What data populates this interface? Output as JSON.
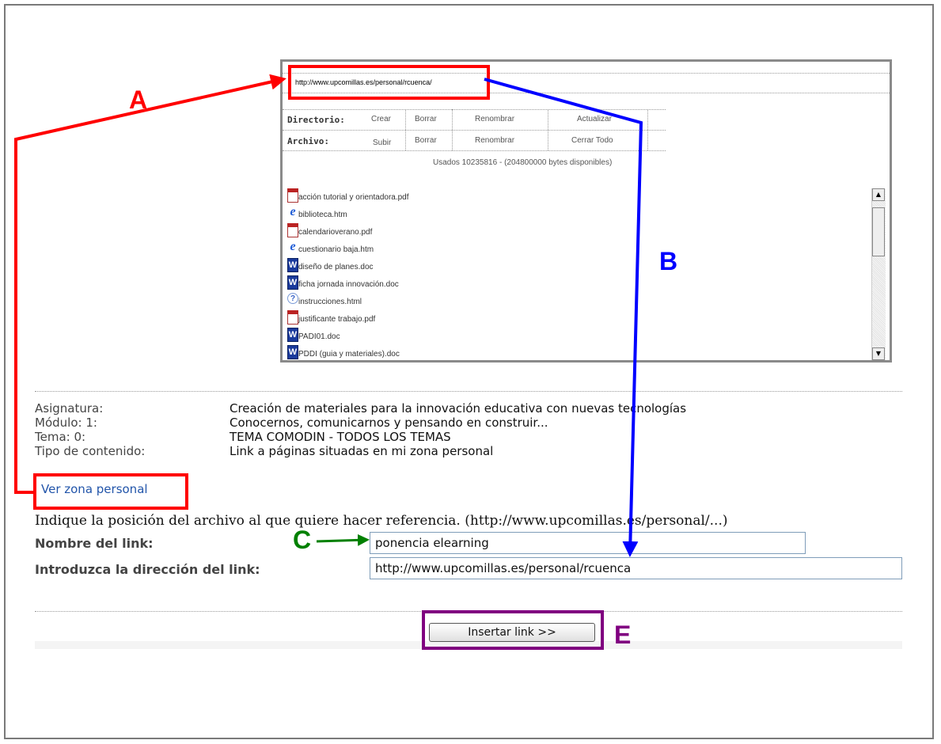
{
  "panel": {
    "url": "http://www.upcomillas.es/personal/rcuenca/",
    "directory_label": "Directorio:",
    "file_label": "Archivo:",
    "directory_actions": [
      "Crear",
      "Borrar",
      "Renombrar",
      "Actualizar"
    ],
    "file_actions": [
      "Subir",
      "Borrar",
      "Renombrar",
      "Cerrar Todo"
    ],
    "usage": "Usados 10235816 - (204800000 bytes disponibles)",
    "files": [
      {
        "name": "acción tutorial y orientadora.pdf",
        "icon": "pdf-icon"
      },
      {
        "name": "biblioteca.htm",
        "icon": "ie-icon"
      },
      {
        "name": "calendarioverano.pdf",
        "icon": "pdf-icon"
      },
      {
        "name": "cuestionario baja.htm",
        "icon": "ie-icon"
      },
      {
        "name": "diseño de planes.doc",
        "icon": "word-icon"
      },
      {
        "name": "ficha jornada innovación.doc",
        "icon": "word-icon"
      },
      {
        "name": "instrucciones.html",
        "icon": "help-icon"
      },
      {
        "name": "justificante trabajo.pdf",
        "icon": "pdf-icon"
      },
      {
        "name": "PADI01.doc",
        "icon": "word-icon"
      },
      {
        "name": "PDDI (guia y materiales).doc",
        "icon": "word-icon"
      }
    ]
  },
  "info": {
    "labels": [
      "Asignatura:",
      "Módulo: 1:",
      "Tema: 0:",
      "Tipo de contenido:"
    ],
    "values": [
      "Creación de materiales para la innovación educativa con nuevas tecnologías",
      "Conocernos, comunicarnos y pensando en construir...",
      "TEMA COMODIN - TODOS LOS TEMAS",
      "Link a páginas situadas en mi zona personal"
    ]
  },
  "form": {
    "personal_link": "Ver zona personal",
    "instructions": "Indique la posición del archivo al que quiere hacer referencia. (http://www.upcomillas.es/personal/...)",
    "name_label": "Nombre del link:",
    "name_value": "ponencia elearning",
    "url_label": "Introduzca la dirección del link:",
    "url_value": "http://www.upcomillas.es/personal/rcuenca",
    "submit_label": "Insertar link >>"
  },
  "annotations": {
    "A": "A",
    "B": "B",
    "C": "C",
    "E": "E",
    "colors": {
      "A": "#ff0000",
      "B": "#0000ff",
      "C": "#008000",
      "E": "#800080"
    }
  }
}
